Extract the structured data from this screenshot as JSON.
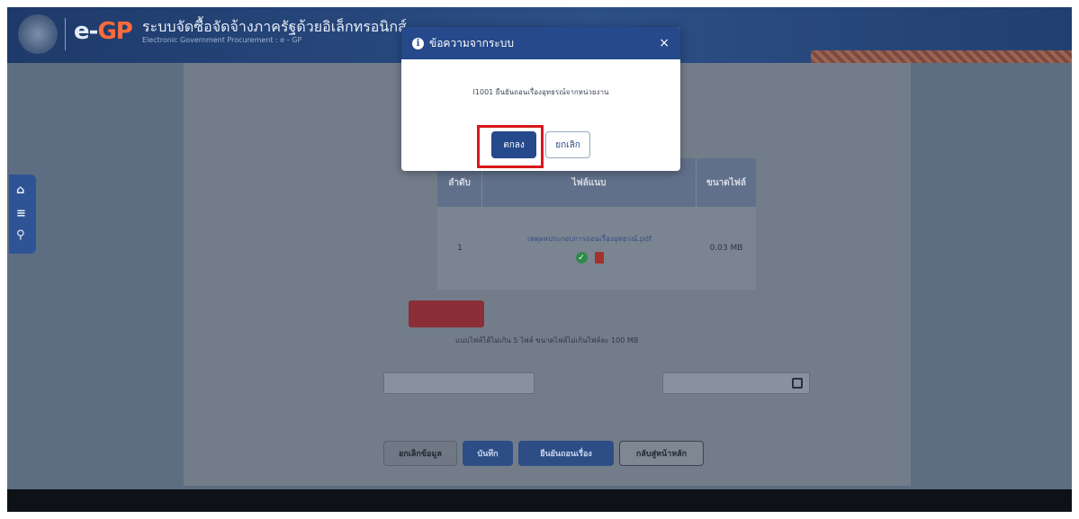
{
  "header": {
    "brand_prefix": "e-",
    "brand_suffix": "GP",
    "title_th": "ระบบจัดซื้อจัดจ้างภาครัฐด้วยอิเล็กทรอนิกส์",
    "title_en": "Electronic Government Procurement : e - GP"
  },
  "sidenav": {
    "home_icon": "home-icon",
    "menu_icon": "menu-icon",
    "search_icon": "search-icon"
  },
  "table": {
    "col_no": "ลำดับ",
    "col_file": "ไฟล์แนบ",
    "col_size": "ขนาดไฟล์",
    "rows": [
      {
        "no": "1",
        "file": "เหตุผลประกอบการถอนเรื่องอุทธรณ์.pdf",
        "size": "0.03 MB"
      }
    ]
  },
  "form": {
    "attach_note": "แนบไฟล์ได้ไม่เกิน 5 ไฟล์ ขนาดไฟล์ไม่เกินไฟล์ละ 100 MB"
  },
  "actions": {
    "cancel": "ยกเลิกข้อมูล",
    "save": "บันทึก",
    "confirm": "ยืนยันถอนเรื่อง",
    "home": "กลับสู่หน้าหลัก"
  },
  "modal": {
    "title": "ข้อความจากระบบ",
    "close": "×",
    "message": "I1001  ยืนยันถอนเรื่องอุทธรณ์จากหน่วยงาน",
    "ok": "ตกลง",
    "cancel": "ยกเลิก",
    "info_icon": "i"
  },
  "colors": {
    "header_bg": "#1e3a6a",
    "modal_header": "#25498a",
    "highlight": "#d9171c"
  }
}
